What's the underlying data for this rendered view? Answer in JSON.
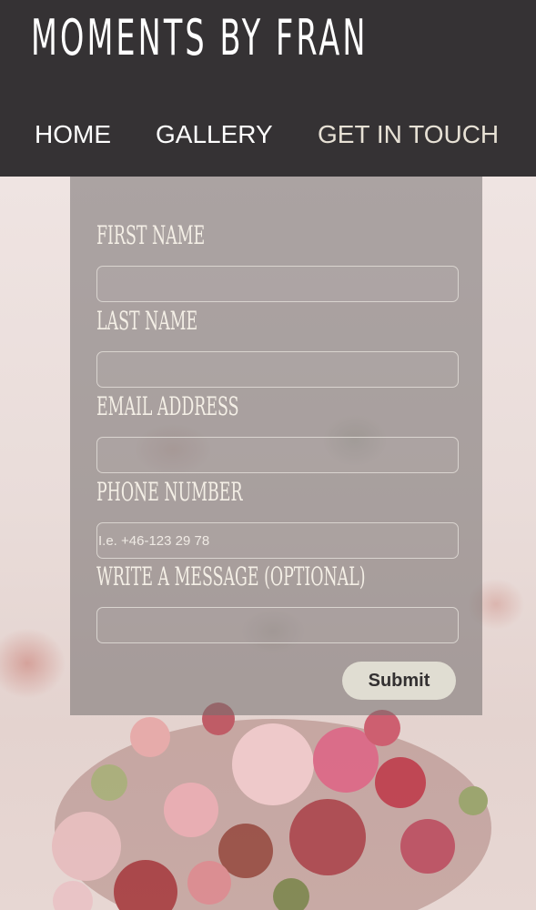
{
  "header": {
    "logo": "MOMENTS BY FRAN",
    "nav": [
      {
        "label": "HOME"
      },
      {
        "label": "GALLERY"
      },
      {
        "label": "GET IN TOUCH",
        "active": true
      }
    ]
  },
  "form": {
    "fields": [
      {
        "label": "First Name",
        "value": "",
        "placeholder": ""
      },
      {
        "label": "Last Name",
        "value": "",
        "placeholder": ""
      },
      {
        "label": "Email Address",
        "value": "",
        "placeholder": ""
      },
      {
        "label": "Phone Number",
        "value": "",
        "placeholder": "I.e. +46-123 29 78"
      },
      {
        "label": "Write a message (optional)",
        "value": "",
        "placeholder": ""
      }
    ],
    "submit_label": "Submit"
  },
  "colors": {
    "header_bg": "#353234",
    "active_nav": "#e7e1d5",
    "button_bg": "#e0ddd2"
  }
}
